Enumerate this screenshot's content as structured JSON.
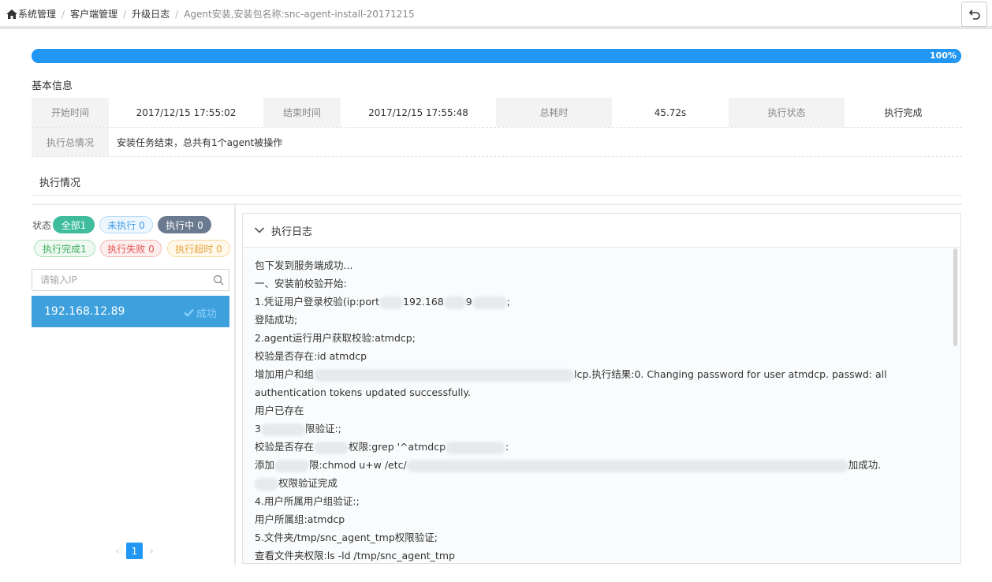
{
  "breadcrumb": {
    "items": [
      "系统管理",
      "客户端管理",
      "升级日志"
    ],
    "current": "Agent安装,安装包名称:snc-agent-install-20171215"
  },
  "progress": {
    "percent": 100,
    "label": "100%",
    "color": "#2196f3"
  },
  "basic_info": {
    "title": "基本信息",
    "start_time_label": "开始时间",
    "start_time": "2017/12/15 17:55:02",
    "end_time_label": "结束时间",
    "end_time": "2017/12/15 17:55:48",
    "duration_label": "总耗时",
    "duration": "45.72s",
    "status_label": "执行状态",
    "status": "执行完成",
    "summary_label": "执行总情况",
    "summary": "安装任务结束，总共有1个agent被操作"
  },
  "execution": {
    "title": "执行情况",
    "status_label": "状态",
    "filters": {
      "all": "全部1",
      "pending": "未执行 0",
      "running": "执行中 0",
      "done": "执行完成1",
      "fail": "执行失败 0",
      "timeout": "执行超时 0"
    },
    "search_placeholder": "请输入IP",
    "hosts": [
      {
        "ip": "192.168.12.89",
        "state": "成功"
      }
    ],
    "pager": {
      "current": "1"
    }
  },
  "log": {
    "title": "执行日志",
    "lines": {
      "l1": "包下发到服务端成功...",
      "l2": "一、安装前校验开始:",
      "l3a": "1.凭证用户登录校验(ip:port",
      "l3b": "192.168",
      "l3c": "9",
      "l3d": ";",
      "l4": "登陆成功;",
      "l5": "2.agent运行用户获取校验:atmdcp;",
      "l6": "校验是否存在:id atmdcp",
      "l7a": "增加用户和组",
      "l7b": "lcp.执行结果:0. Changing password for user atmdcp. passwd: all authentication tokens updated successfully.",
      "l8": "用户已存在",
      "l9a": "3",
      "l9b": "限验证:;",
      "l10a": "校验是否存在",
      "l10b": "权限:grep '^atmdcp",
      "l10c": ":",
      "l11a": "添加",
      "l11b": "限:chmod u+w /etc/",
      "l11c": "加成功.",
      "l12": "权限验证完成",
      "l13": "4.用户所属用户组验证:;",
      "l14": "用户所属组:atmdcp",
      "l15": "5.文件夹/tmp/snc_agent_tmp权限验证;",
      "l16": "查看文件夹权限:ls -ld /tmp/snc_agent_tmp"
    }
  }
}
